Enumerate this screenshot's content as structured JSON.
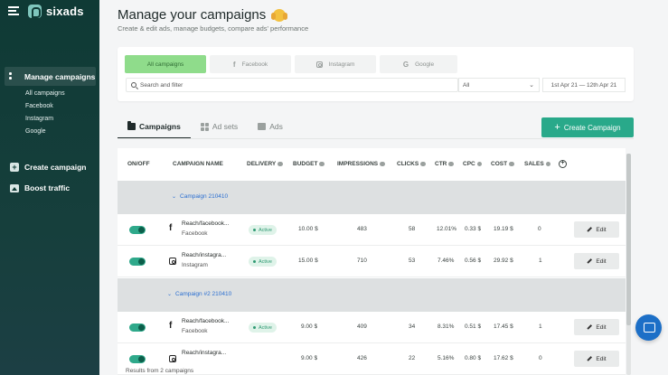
{
  "brand": {
    "name": "sixads"
  },
  "sidebar": {
    "main_item": "Manage campaigns",
    "sub_items": [
      "All campaigns",
      "Facebook",
      "Instagram",
      "Google"
    ],
    "create_campaign": "Create campaign",
    "boost_traffic": "Boost traffic"
  },
  "header": {
    "title": "Manage your campaigns",
    "subtitle": "Create & edit ads, manage budgets, compare ads' performance"
  },
  "filters": {
    "platform_tabs": [
      "All campaigns",
      "Facebook",
      "Instagram",
      "Google"
    ],
    "active_tab": "All campaigns",
    "search_placeholder": "Search and filter",
    "status_select": "All",
    "date_range": "1st Apr 21  — 12th Apr 21"
  },
  "tabs": {
    "campaigns": "Campaigns",
    "ad_sets": "Ad sets",
    "ads": "Ads"
  },
  "create_button": "Create Campaign",
  "table": {
    "headers": {
      "onoff": "ON/OFF",
      "campaign_name": "CAMPAIGN NAME",
      "delivery": "DELIVERY",
      "budget": "BUDGET",
      "impressions": "IMPRESSIONS",
      "clicks": "CLICKS",
      "ctr": "CTR",
      "cpc": "CPC",
      "cost": "COST",
      "sales": "SALES"
    },
    "groups": [
      {
        "name": "Campaign 210410",
        "rows": [
          {
            "name": "Reach/facebook...",
            "platform": "Facebook",
            "delivery": "Active",
            "budget": "10.00 $",
            "impressions": "483",
            "clicks": "58",
            "ctr": "12.01%",
            "cpc": "0.33 $",
            "cost": "19.19 $",
            "sales": "0",
            "edit": "Edit",
            "icon": "facebook-icon"
          },
          {
            "name": "Reach/instagra...",
            "platform": "Instagram",
            "delivery": "Active",
            "budget": "15.00 $",
            "impressions": "710",
            "clicks": "53",
            "ctr": "7.46%",
            "cpc": "0.56 $",
            "cost": "29.92 $",
            "sales": "1",
            "edit": "Edit",
            "icon": "instagram-icon"
          }
        ]
      },
      {
        "name": "Campaign #2 210410",
        "rows": [
          {
            "name": "Reach/facebook...",
            "platform": "Facebook",
            "delivery": "Active",
            "budget": "9.00 $",
            "impressions": "409",
            "clicks": "34",
            "ctr": "8.31%",
            "cpc": "0.51 $",
            "cost": "17.45 $",
            "sales": "1",
            "edit": "Edit",
            "icon": "facebook-icon"
          },
          {
            "name": "Reach/instagra...",
            "platform": "",
            "delivery": "",
            "budget": "9.00 $",
            "impressions": "426",
            "clicks": "22",
            "ctr": "5.16%",
            "cpc": "0.80 $",
            "cost": "17.62 $",
            "sales": "0",
            "edit": "Edit",
            "icon": "instagram-icon"
          }
        ]
      }
    ]
  },
  "footer": {
    "results": "Results from 2 campaigns"
  },
  "colors": {
    "sidebar": "#0f3a35",
    "accent": "#29a98a",
    "link": "#2b6fd1",
    "active_filter": "#8fdc8b"
  }
}
